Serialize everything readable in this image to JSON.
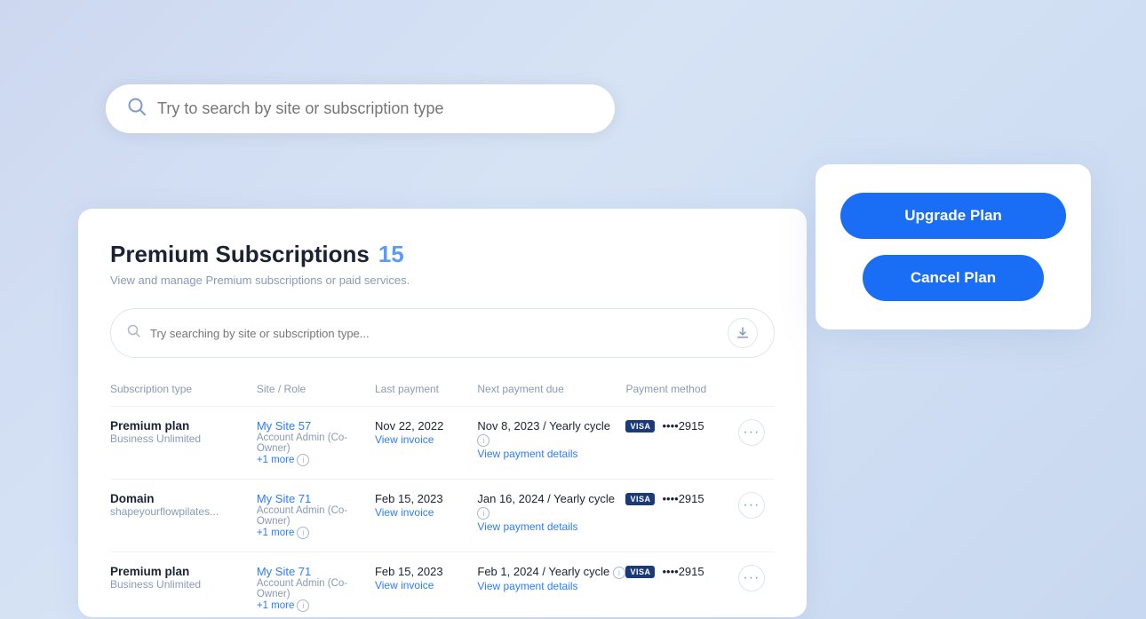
{
  "search": {
    "placeholder": "Try to search by site or subscription type",
    "inner_placeholder": "Try searching by site or subscription type...",
    "icon": "🔍"
  },
  "action_panel": {
    "upgrade_label": "Upgrade Plan",
    "cancel_label": "Cancel Plan"
  },
  "card": {
    "title": "Premium Subscriptions",
    "count": "15",
    "subtitle": "View and manage Premium subscriptions or paid services.",
    "download_icon": "⬇"
  },
  "table": {
    "columns": [
      "Subscription type",
      "Site / Role",
      "Last payment",
      "Next payment due",
      "Payment method",
      ""
    ],
    "rows": [
      {
        "sub_type": "Premium plan",
        "sub_detail": "Business Unlimited",
        "site_name": "My Site 57",
        "site_role": "Account Admin (Co-Owner)",
        "site_more": "+1 more",
        "last_payment": "Nov 22, 2022",
        "view_invoice": "View invoice",
        "next_payment": "Nov 8, 2023 / Yearly cycle",
        "view_payment": "View payment details",
        "payment_method": "VISA",
        "card_num": "••••2915"
      },
      {
        "sub_type": "Domain",
        "sub_detail": "shapeyourflowpilates...",
        "site_name": "My Site 71",
        "site_role": "Account Admin (Co-Owner)",
        "site_more": "+1 more",
        "last_payment": "Feb 15, 2023",
        "view_invoice": "View invoice",
        "next_payment": "Jan 16, 2024 / Yearly cycle",
        "view_payment": "View payment details",
        "payment_method": "VISA",
        "card_num": "••••2915"
      },
      {
        "sub_type": "Premium plan",
        "sub_detail": "Business Unlimited",
        "site_name": "My Site 71",
        "site_role": "Account Admin (Co-Owner)",
        "site_more": "+1 more",
        "last_payment": "Feb 15, 2023",
        "view_invoice": "View invoice",
        "next_payment": "Feb 1, 2024 / Yearly cycle",
        "view_payment": "View payment details",
        "payment_method": "VISA",
        "card_num": "••••2915"
      }
    ]
  }
}
